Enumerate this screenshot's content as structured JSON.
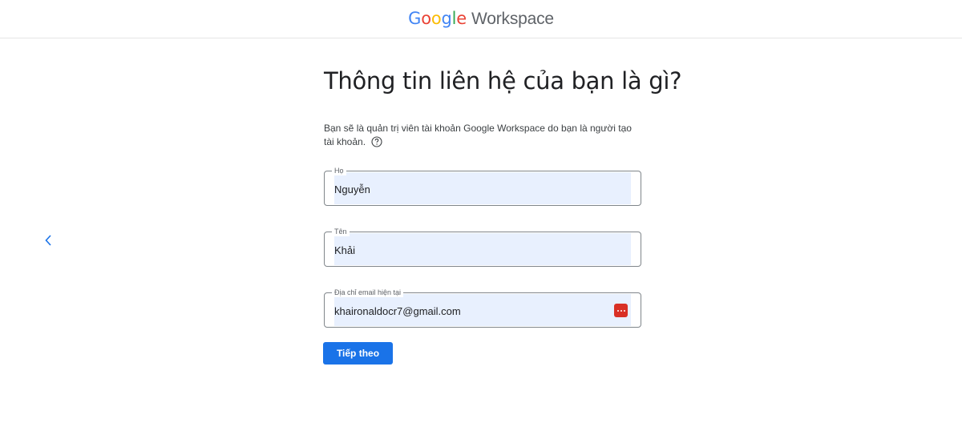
{
  "header": {
    "logo_letters": [
      {
        "ch": "G",
        "color": "#4285F4"
      },
      {
        "ch": "o",
        "color": "#EA4335"
      },
      {
        "ch": "o",
        "color": "#FBBC05"
      },
      {
        "ch": "g",
        "color": "#4285F4"
      },
      {
        "ch": "l",
        "color": "#34A853"
      },
      {
        "ch": "e",
        "color": "#EA4335"
      }
    ],
    "product": "Workspace"
  },
  "page": {
    "title": "Thông tin liên hệ của bạn là gì?",
    "description": "Bạn sẽ là quản trị viên tài khoản Google Workspace do bạn là người tạo tài khoản."
  },
  "form": {
    "last_name": {
      "label": "Họ",
      "value": "Nguyễn"
    },
    "first_name": {
      "label": "Tên",
      "value": "Khải"
    },
    "email": {
      "label": "Địa chỉ email hiện tại",
      "value": "khaironaldocr7@gmail.com"
    },
    "next_label": "Tiếp theo"
  },
  "icons": {
    "back": "chevron-left-icon",
    "help": "help-circle-icon",
    "password_manager": "password-manager-icon"
  },
  "colors": {
    "accent": "#1a73e8",
    "autofill": "#e8f0fe",
    "password_manager": "#d93025"
  }
}
